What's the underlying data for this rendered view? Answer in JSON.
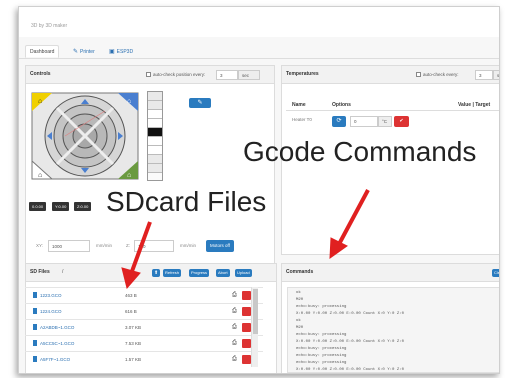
{
  "tagline": "3D by 3D maker",
  "tabs": [
    {
      "label": "Dashboard",
      "icon": "",
      "active": true
    },
    {
      "label": "Printer",
      "icon": "wrench-icon",
      "active": false
    },
    {
      "label": "ESP3D",
      "icon": "monitor-icon",
      "active": false
    }
  ],
  "controls": {
    "title": "Controls",
    "autocheck_label": "auto-check position every:",
    "autocheck_value": "3",
    "autocheck_unit": "sec",
    "position_buttons": [
      "0.0.00",
      "Y:0.00",
      "Z:0.00"
    ],
    "feed": {
      "xy_label": "XY:",
      "xy_value": "1000",
      "xy_unit": "mm/min",
      "z_label": "Z:",
      "z_value": "100",
      "z_unit": "mm/min",
      "motors_off": "Motors off"
    }
  },
  "temperatures": {
    "title": "Temperatures",
    "autocheck_label": "auto-check every:",
    "autocheck_value": "3",
    "autocheck_unit": "sec",
    "col_name": "Name",
    "col_options": "Options",
    "col_value": "Value | Target",
    "heater_label": "Heater T0",
    "heater_value": "0",
    "heater_unit": "°C"
  },
  "sdfiles": {
    "title": "SD Files",
    "path": "/",
    "buttons": [
      "Refresh",
      "Progress",
      "Abort",
      "Upload"
    ],
    "files": [
      {
        "name": "1223.GCO",
        "size": "463 B"
      },
      {
        "name": "1224.GCO",
        "size": "616 B"
      },
      {
        "name": "A2ABDB~1.GCO",
        "size": "3.07 KB"
      },
      {
        "name": "A5CC5C~1.GCO",
        "size": "7.53 KB"
      },
      {
        "name": "A5F7F~1.GCO",
        "size": "1.57 KB"
      }
    ]
  },
  "commands": {
    "title": "Commands",
    "clear_label": "Clear",
    "log": [
      "ok",
      "M20",
      "echo:busy: processing",
      "X:0.00 Y:0.00 Z:0.00 E:0.00 Count X:0 Y:0 Z:0",
      "ok",
      "M20",
      "echo:busy: processing",
      "X:0.00 Y:0.00 Z:0.00 E:0.00 Count X:0 Y:0 Z:0",
      "echo:busy: processing",
      "echo:busy: processing",
      "echo:busy: processing",
      "X:0.00 Y:0.00 Z:0.00 E:0.00 Count X:0 Y:0 Z:0"
    ]
  },
  "annotations": {
    "gcode": "Gcode Commands",
    "sdcard": "SDcard Files"
  },
  "colors": {
    "accent": "#2a7bbf",
    "danger": "#d33333",
    "arrow": "#e02020"
  }
}
